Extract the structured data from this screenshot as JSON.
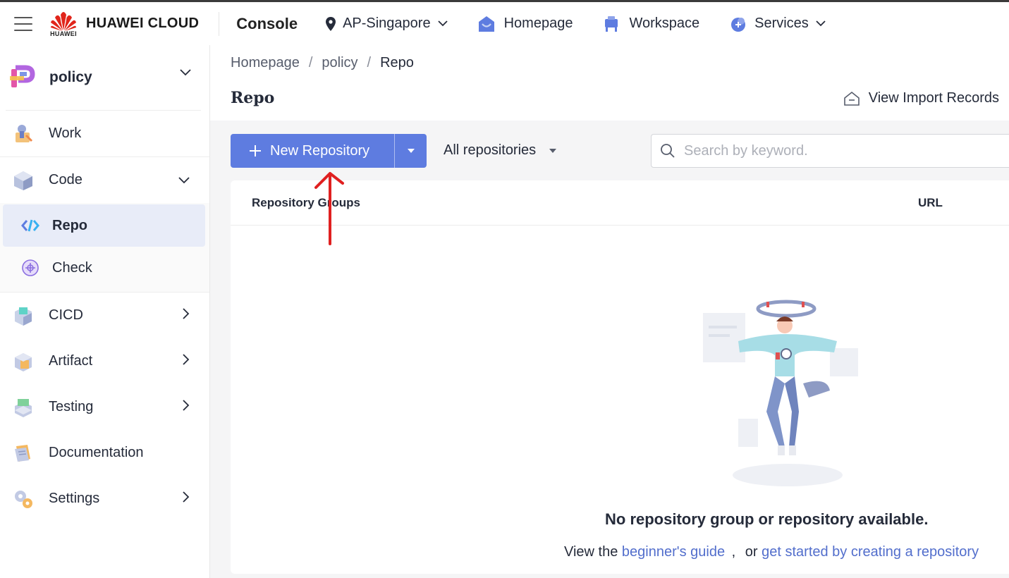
{
  "header": {
    "logo_text": "HUAWEI CLOUD",
    "logo_sub": "HUAWEI",
    "console": "Console",
    "region": "AP-Singapore",
    "nav": {
      "homepage": "Homepage",
      "workspace": "Workspace",
      "services": "Services"
    }
  },
  "sidebar": {
    "project": "policy",
    "items": {
      "work": "Work",
      "code": "Code",
      "repo": "Repo",
      "check": "Check",
      "cicd": "CICD",
      "artifact": "Artifact",
      "testing": "Testing",
      "documentation": "Documentation",
      "settings": "Settings"
    }
  },
  "breadcrumb": {
    "home": "Homepage",
    "project": "policy",
    "current": "Repo",
    "sep": "/"
  },
  "page": {
    "title": "Repo",
    "import_records": "View Import Records"
  },
  "toolbar": {
    "new_repo": "New Repository",
    "filter": "All repositories",
    "search_placeholder": "Search by keyword."
  },
  "table": {
    "col_groups": "Repository Groups",
    "col_url": "URL"
  },
  "empty": {
    "title": "No repository group or repository available.",
    "prefix": "View the",
    "guide_link": "beginner's guide",
    "comma": ",",
    "or": "or",
    "create_link": "get started by creating a repository"
  },
  "colors": {
    "primary": "#5e7ce0",
    "link": "#526ecc",
    "active_bg": "#e8ecf8",
    "annotation": "#e02020"
  }
}
